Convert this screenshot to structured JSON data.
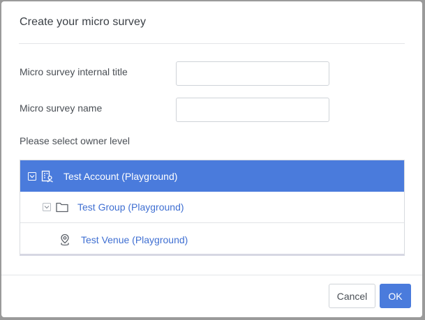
{
  "dialog": {
    "title": "Create your micro survey"
  },
  "form": {
    "internal_title_label": "Micro survey internal title",
    "internal_title_value": "",
    "name_label": "Micro survey name",
    "name_value": "",
    "owner_level_label": "Please select owner level"
  },
  "tree": {
    "items": [
      {
        "label": "Test Account (Playground)",
        "icon": "account-icon",
        "toggle": "collapse-toggle-icon",
        "selected": true
      },
      {
        "label": "Test Group (Playground)",
        "icon": "folder-icon",
        "toggle": "collapse-toggle-icon",
        "selected": false
      },
      {
        "label": "Test Venue (Playground)",
        "icon": "location-pin-icon",
        "selected": false
      }
    ]
  },
  "footer": {
    "cancel_label": "Cancel",
    "ok_label": "OK"
  },
  "colors": {
    "accent": "#4a7bdc",
    "link": "#3f6fd2",
    "overlay": "#9a9a9a"
  }
}
